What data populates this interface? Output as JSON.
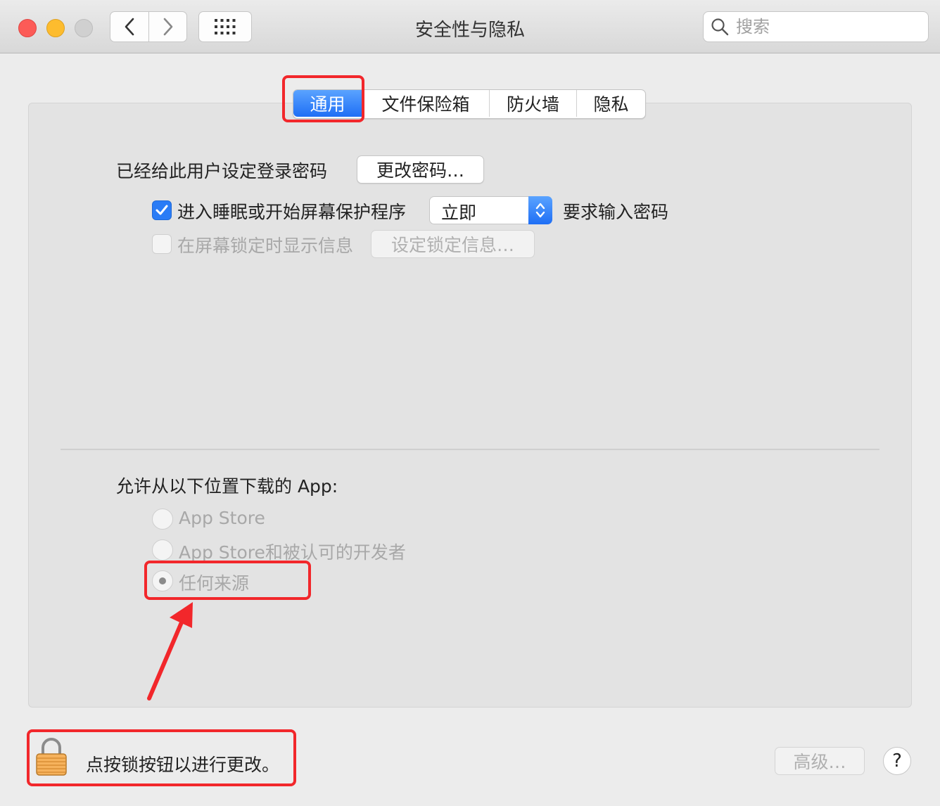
{
  "window": {
    "title": "安全性与隐私"
  },
  "search": {
    "placeholder": "搜索"
  },
  "tabs": [
    {
      "label": "通用",
      "active": true
    },
    {
      "label": "文件保险箱",
      "active": false
    },
    {
      "label": "防火墙",
      "active": false
    },
    {
      "label": "隐私",
      "active": false
    }
  ],
  "general": {
    "password_label": "已经给此用户设定登录密码",
    "change_password_button": "更改密码…",
    "sleep_checkbox_label": "进入睡眠或开始屏幕保护程序",
    "sleep_checkbox_checked": true,
    "require_delay_value": "立即",
    "require_password_label": "要求输入密码",
    "lock_message_checkbox_label": "在屏幕锁定时显示信息",
    "lock_message_checkbox_checked": false,
    "set_lock_message_button": "设定锁定信息…"
  },
  "downloads": {
    "heading": "允许从以下位置下载的 App:",
    "options": [
      {
        "label": "App Store",
        "selected": false
      },
      {
        "label": "App Store和被认可的开发者",
        "selected": false
      },
      {
        "label": "任何来源",
        "selected": true
      }
    ]
  },
  "footer": {
    "lock_text": "点按锁按钮以进行更改。",
    "advanced_button": "高级…",
    "help_button": "?"
  },
  "colors": {
    "accent": "#2a7cf6",
    "highlight": "#f2272b",
    "close": "#fc5b57",
    "minimize": "#fdbc2e",
    "zoom": "#d0d0d0"
  }
}
